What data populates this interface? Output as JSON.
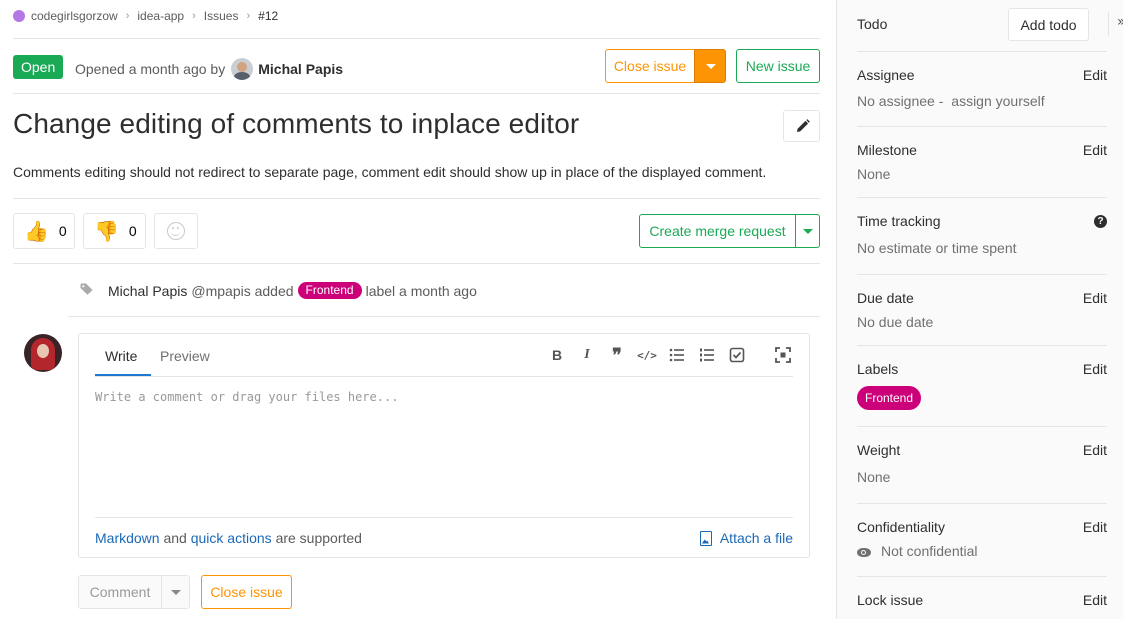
{
  "breadcrumb": {
    "items": [
      "codegirlsgorzow",
      "idea-app",
      "Issues",
      "#12"
    ]
  },
  "issue": {
    "status": "Open",
    "opened_text": "Opened a month ago by",
    "author": "Michal Papis",
    "title": "Change editing of comments to inplace editor",
    "description": "Comments editing should not redirect to separate page, comment edit should show up in place of the displayed comment."
  },
  "header_buttons": {
    "close_issue": "Close issue",
    "new_issue": "New issue"
  },
  "awards": {
    "thumbs_up_count": "0",
    "thumbs_down_count": "0"
  },
  "merge_request": {
    "label": "Create merge request"
  },
  "system_note": {
    "author": "Michal Papis",
    "text_before": "@mpapis added",
    "label": "Frontend",
    "text_after": "label a month ago"
  },
  "comment_form": {
    "tab_write": "Write",
    "tab_preview": "Preview",
    "placeholder": "Write a comment or drag your files here...",
    "footer_markdown": "Markdown",
    "footer_and": "and",
    "footer_quick_actions": "quick actions",
    "footer_supported": "are supported",
    "attach_file": "Attach a file",
    "comment_button": "Comment",
    "close_issue_button": "Close issue"
  },
  "sidebar": {
    "todo": {
      "title": "Todo",
      "button": "Add todo"
    },
    "edit_label": "Edit",
    "assignee": {
      "title": "Assignee",
      "value": "No assignee -",
      "assign_link": "assign yourself"
    },
    "milestone": {
      "title": "Milestone",
      "value": "None"
    },
    "time_tracking": {
      "title": "Time tracking",
      "value": "No estimate or time spent"
    },
    "due_date": {
      "title": "Due date",
      "value": "No due date"
    },
    "labels": {
      "title": "Labels",
      "label": "Frontend"
    },
    "weight": {
      "title": "Weight",
      "value": "None"
    },
    "confidentiality": {
      "title": "Confidentiality",
      "value": "Not confidential"
    },
    "lock_issue": {
      "title": "Lock issue"
    }
  },
  "colors": {
    "open_badge": "#1aaa55",
    "close_orange": "#fc9403",
    "label_frontend": "#cc0078",
    "link_blue": "#1b69b6"
  }
}
